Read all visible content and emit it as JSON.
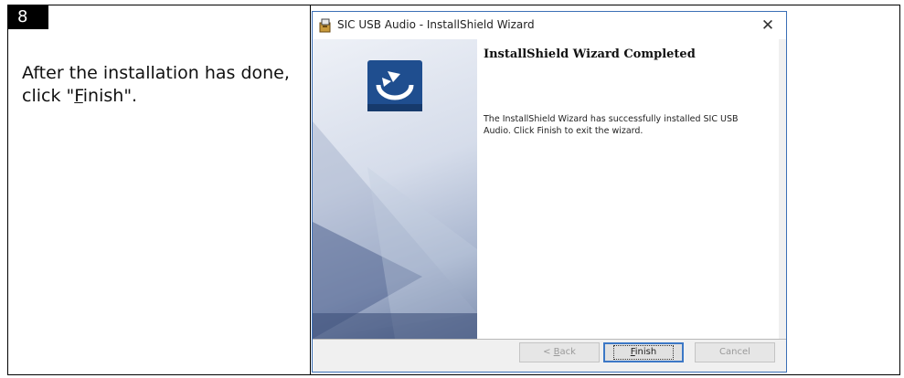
{
  "step": {
    "number": "8"
  },
  "instruction": {
    "line1": "After the installation has done,",
    "line2_pre": "click \"",
    "line2_underlined": "F",
    "line2_rest": "inish\"."
  },
  "dialog": {
    "title": "SIC USB Audio - InstallShield Wizard",
    "close_glyph": "✕",
    "heading": "InstallShield Wizard Completed",
    "description": "The InstallShield Wizard has successfully installed SIC USB Audio. Click Finish to exit the wizard.",
    "buttons": {
      "back_pre": "< ",
      "back_underlined": "B",
      "back_rest": "ack",
      "finish_underlined": "F",
      "finish_rest": "inish",
      "cancel": "Cancel"
    }
  },
  "icons": {
    "title_icon": "installer-icon",
    "banner_logo": "installshield-logo-icon"
  }
}
